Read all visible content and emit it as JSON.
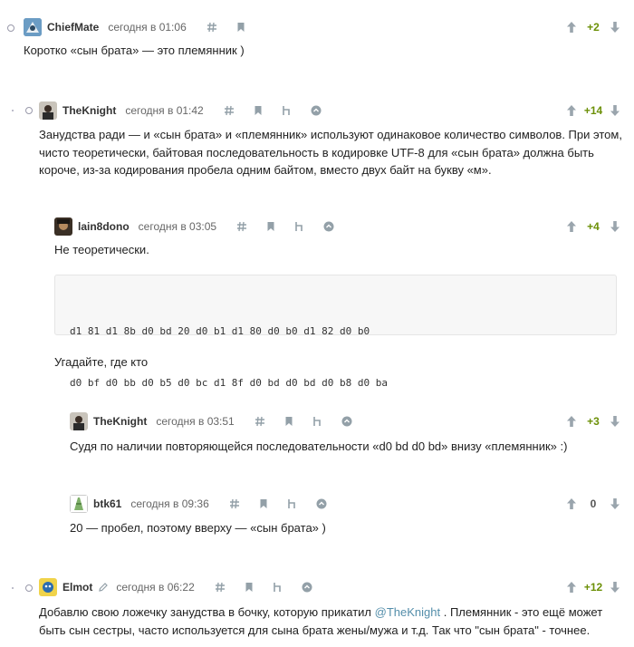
{
  "icons": {
    "upvote": "arrow-up-icon",
    "downvote": "arrow-down-icon",
    "anchor": "hash-icon",
    "bookmark": "bookmark-icon",
    "parent": "parent-link-icon",
    "branch": "branch-icon",
    "edited": "pencil-icon"
  },
  "colors": {
    "positive_score": "#6c9007",
    "icon": "#93a0a8",
    "mention": "#548eaa"
  },
  "comments": [
    {
      "user": "ChiefMate",
      "time": "сегодня в 01:06",
      "score": "+2",
      "text": "Коротко «сын брата» — это племянник )"
    },
    {
      "user": "TheKnight",
      "time": "сегодня в 01:42",
      "score": "+14",
      "text_lines": [
        "Занудства ради — и «сын брата» и «племянник» используют одинаковое количество символов. При этом,",
        "чисто теоретически, байтовая последовательность в кодировке UTF-8 для «сын брата» должна быть",
        "короче, из-за кодирования пробела одним байтом, вместо двух байт на букву «м»."
      ]
    },
    {
      "user": "lain8dono",
      "time": "сегодня в 03:05",
      "score": "+4",
      "text": "Не теоретически.",
      "code_lines": [
        "d1 81 d1 8b d0 bd 20 d0 b1 d1 80 d0 b0 d1 82 d0 b0",
        "d0 bf d0 bb d0 b5 d0 bc d1 8f d0 bd d0 bd d0 b8 d0 ba"
      ],
      "text2": "Угадайте, где кто"
    },
    {
      "user": "TheKnight",
      "time": "сегодня в 03:51",
      "score": "+3",
      "text": "Судя по наличии повторяющейся последовательности «d0 bd d0 bd» внизу «племянник» :)"
    },
    {
      "user": "btk61",
      "time": "сегодня в 09:36",
      "score": "0",
      "text": "20 — пробел, поэтому вверху — «сын брата» )"
    },
    {
      "user": "Elmot",
      "time": "сегодня в 06:22",
      "score": "+12",
      "text_line1_before": "Добавлю свою ложечку занудства в бочку, которую прикатил ",
      "mention": "@TheKnight",
      "text_line1_after": " . Племянник - это ещё может",
      "text_line2": "быть сын сестры, часто используется для сына брата жены/мужа и т.д. Так что \"сын брата\" - точнее."
    }
  ]
}
